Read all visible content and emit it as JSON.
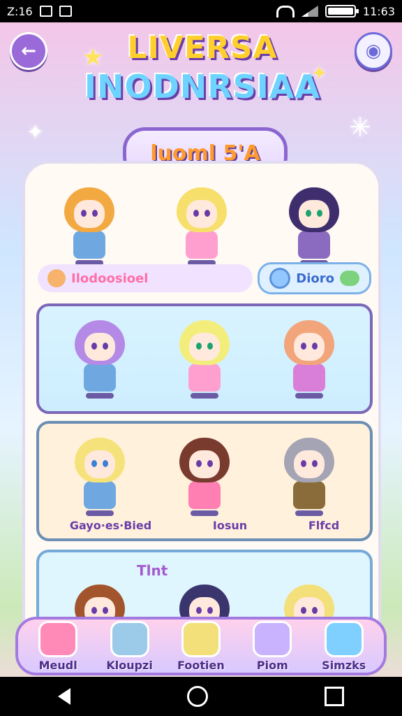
{
  "status_bar": {
    "time_left": "Z:16",
    "time_right": "11:63"
  },
  "header": {
    "title_line1": "LIVERSA",
    "title_line2": "INODNRSIAA"
  },
  "banner": {
    "label": "luoml 5'A"
  },
  "section_bar": {
    "left_label": "Ilodoosioel",
    "right_label": "Dioro"
  },
  "cards": [
    {
      "labels": []
    },
    {
      "labels": [
        "Gayo·es·Bied",
        "Iosun",
        "Flfcd"
      ]
    },
    {
      "title": "Tlnt",
      "labels": []
    }
  ],
  "bottom_nav": [
    {
      "label": "Meudl",
      "icon": "character-avatar-icon"
    },
    {
      "label": "Kloupzi",
      "icon": "character-avatar-icon"
    },
    {
      "label": "Footien",
      "icon": "character-avatar-icon"
    },
    {
      "label": "Piom",
      "icon": "rocket-icon"
    },
    {
      "label": "Simzks",
      "icon": "card-icon"
    }
  ],
  "colors": {
    "accent": "#8c66d0",
    "pink": "#ff8ab8",
    "blue": "#6fd3ff",
    "yellow": "#ffcf2e"
  }
}
